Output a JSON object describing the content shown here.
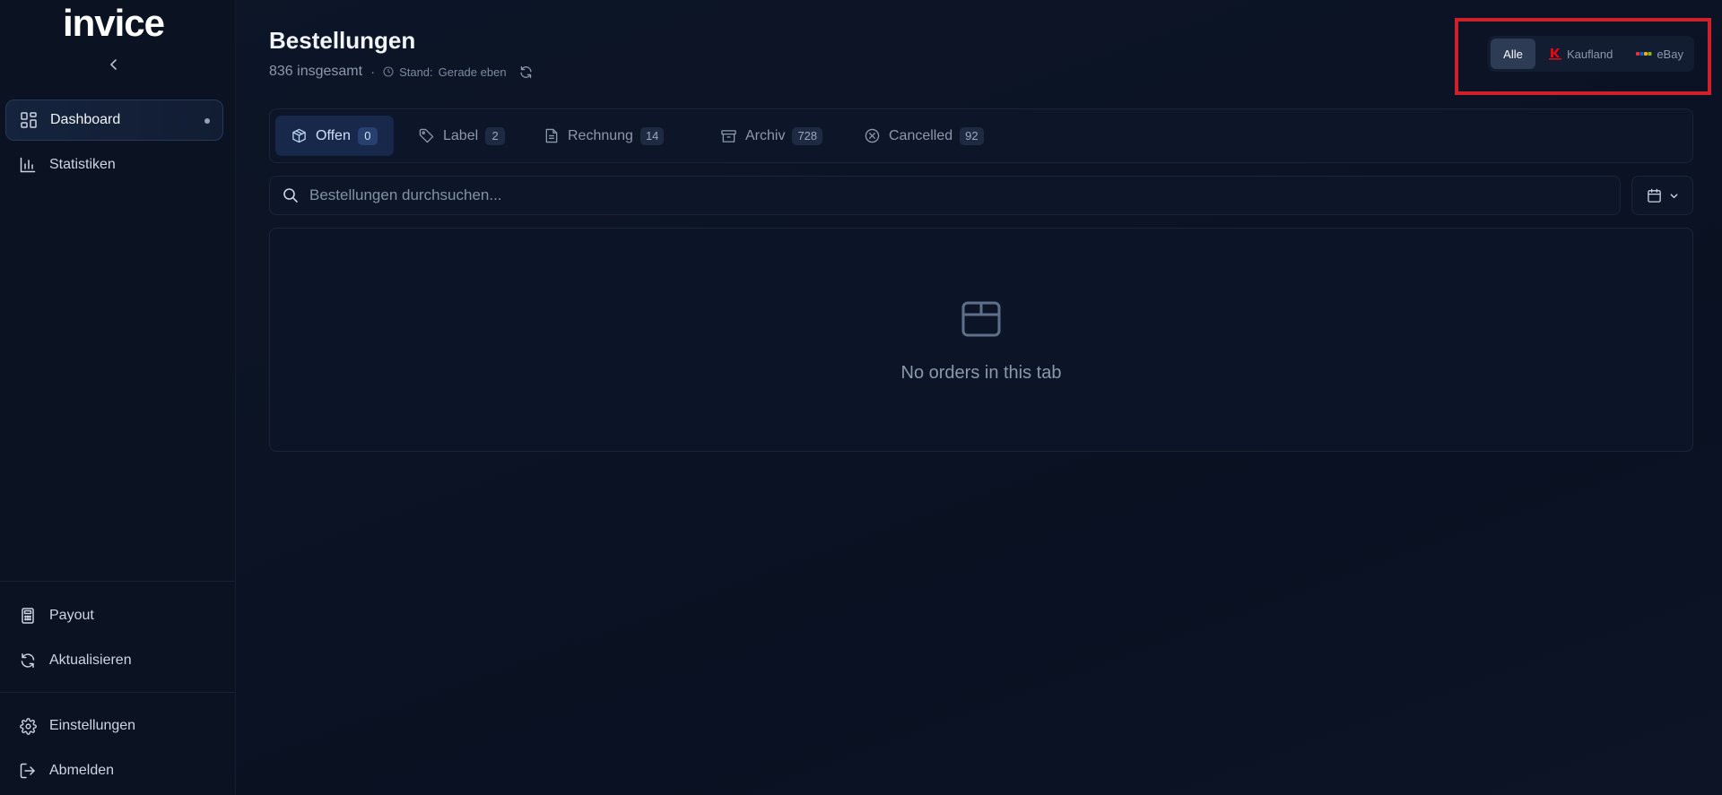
{
  "brand": {
    "logo_text": "invice"
  },
  "sidebar": {
    "items_top": [
      {
        "label": "Dashboard",
        "icon": "dashboard-grid-icon",
        "active": true
      },
      {
        "label": "Statistiken",
        "icon": "bar-chart-icon"
      }
    ],
    "items_bottom": [
      {
        "label": "Payout",
        "icon": "calculator-icon"
      },
      {
        "label": "Aktualisieren",
        "icon": "refresh-icon"
      },
      {
        "label": "Einstellungen",
        "icon": "gear-icon"
      },
      {
        "label": "Abmelden",
        "icon": "logout-icon"
      }
    ]
  },
  "header": {
    "title": "Bestellungen",
    "total": "836 insgesamt",
    "separator": "·",
    "status_label": "Stand:",
    "status_value": "Gerade eben"
  },
  "platform_filter": {
    "options": [
      {
        "label": "Alle",
        "active": true
      },
      {
        "label": "Kaufland",
        "icon": "kaufland-logo-icon",
        "color": "#e10915"
      },
      {
        "label": "eBay",
        "icon": "ebay-logo-icon"
      }
    ]
  },
  "tabs": [
    {
      "label": "Offen",
      "count": "0",
      "icon": "package-icon",
      "active": true
    },
    {
      "label": "Label",
      "count": "2",
      "icon": "tag-icon"
    },
    {
      "label": "Rechnung",
      "count": "14",
      "icon": "document-icon"
    },
    {
      "label": "Archiv",
      "count": "728",
      "icon": "archive-icon"
    },
    {
      "label": "Cancelled",
      "count": "92",
      "icon": "cancel-circle-icon"
    }
  ],
  "search": {
    "placeholder": "Bestellungen durchsuchen...",
    "value": ""
  },
  "empty_state": {
    "icon": "box-icon",
    "message": "No orders in this tab"
  },
  "colors": {
    "background": "#0b1324",
    "accent": "#17284a",
    "highlight_outline": "#d0202b"
  }
}
